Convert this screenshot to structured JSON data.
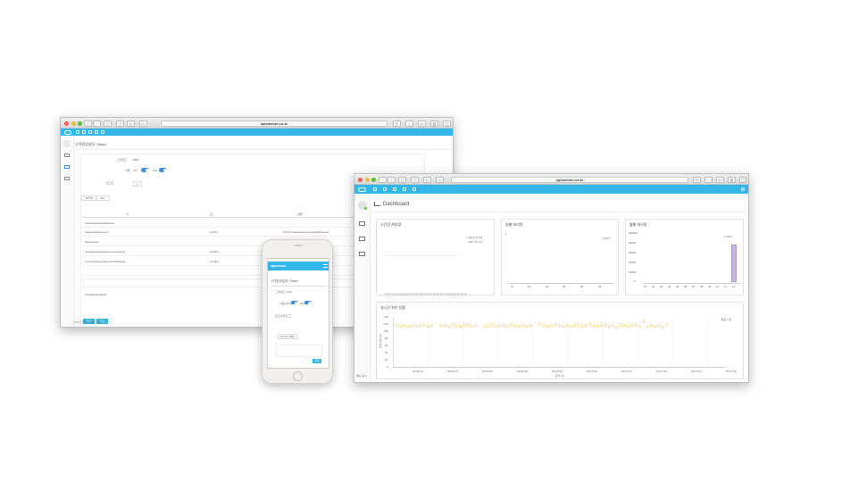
{
  "left_window": {
    "url": "spicmeem.co.kr",
    "breadcrumb": "고객환경설정 / Basic",
    "form": {
      "row1_label": "고객코드",
      "row1_value": "ACS",
      "row2_label": "사용",
      "row2_toggle_a": "ON",
      "row2_toggle_b": "SSL",
      "row3_label": "로그인",
      "row3_value": "1"
    },
    "tabs": [
      "HTTP",
      "SSL"
    ],
    "table": {
      "headers": [
        "키",
        "값",
        "설명"
      ],
      "rows": [
        [
          "mrtdiscagwiCooktKalues",
          "",
          ""
        ],
        [
          "paasurednwloo.com",
          "portfol",
          "ferever faardernaecoo fasdaddoecosia"
        ],
        [
          "Serashoras",
          "",
          ""
        ],
        [
          "rieswprikeedaswaenrcesnarkdoca",
          "wardlet",
          ""
        ],
        [
          "riesvcwoelrgyprikegshiirmtfaddoja",
          "sendise",
          ""
        ],
        [
          "",
          "",
          ""
        ],
        [
          "associatrasedtrate",
          "",
          ""
        ]
      ]
    },
    "buttons": [
      "저장",
      "취소"
    ],
    "footer": "스파르타 일반 / 회원가입 관리"
  },
  "right_window": {
    "url": "spicmeem.co.kr",
    "page_title": "Dashboard",
    "cards": {
      "card1_title": "시간당 처리량",
      "card1_legend": [
        "2017-07-18",
        "2017-07-19"
      ],
      "card2_title": "일별 처리량",
      "card2_legend": "2017",
      "card2_xticks": [
        "01",
        "02",
        "03",
        "04",
        "05",
        "06"
      ],
      "card2_ylabel": "1",
      "card3_title": "월별 처리량",
      "card3_legend": "2017",
      "card3_yticks": [
        "100000",
        "80000",
        "60000",
        "40000",
        "20000",
        "0"
      ],
      "card3_xticks": [
        "01",
        "02",
        "03",
        "04",
        "05",
        "06",
        "07",
        "08",
        "09",
        "10",
        "11",
        "12"
      ],
      "card4_title": "실시간 처리 상황",
      "card4_legend": "응답 시간",
      "card4_yticks": [
        "140",
        "120",
        "100",
        "80",
        "60",
        "40",
        "20",
        "0"
      ],
      "card4_xticks": [
        "02:36:10",
        "02:36:20",
        "02:36:30",
        "02:36:40",
        "02:36:50",
        "02:37:00",
        "02:37:10",
        "02:37:20",
        "02:37:30",
        "02:37:40"
      ],
      "card4_xlabel": "응답시간",
      "card4_ylabel": "응답시간(ms)"
    },
    "footer": "메뉴 표시"
  },
  "phone": {
    "brand": "spicmeem",
    "breadcrumb": "고객환경설정 / Basic",
    "field1_label": "고객코드",
    "field1_value": "ACS",
    "toggle_label": "사용",
    "toggle_a": "HTTP",
    "toggle_b": "SSL",
    "field3_label": "로그인유지",
    "tab_a": "HTTP",
    "tab_b": "SSL",
    "button": "저장"
  }
}
